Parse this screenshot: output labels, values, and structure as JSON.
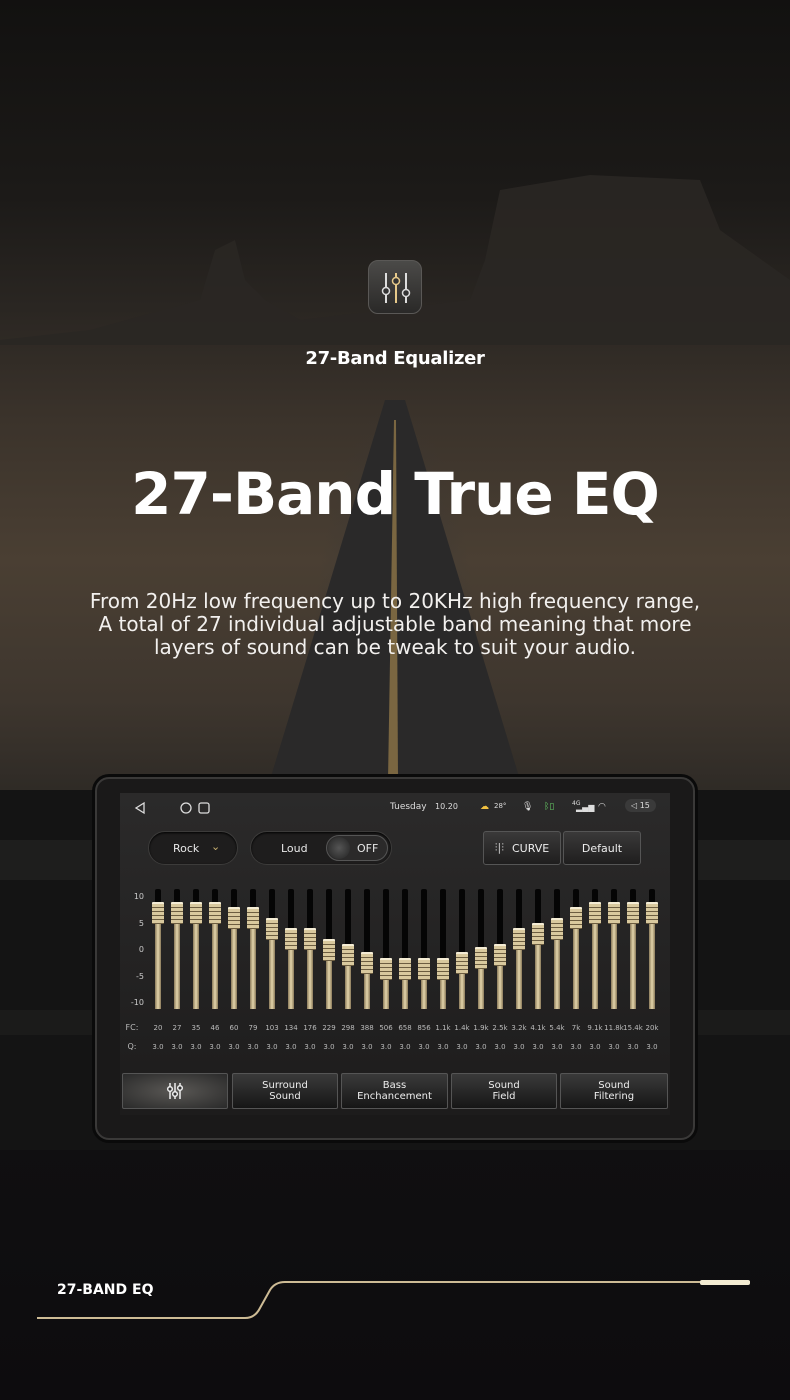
{
  "header": {
    "icon": "equalizer-sliders-icon",
    "subtitle": "27-Band Equalizer",
    "title": "27-Band True EQ",
    "description": [
      "From 20Hz low frequency up to 20KHz high frequency range,",
      "A total of 27 individual adjustable band meaning that more",
      "layers of sound can be tweak to suit your audio."
    ]
  },
  "status_bar": {
    "day": "Tuesday",
    "time": "10.20",
    "temperature": "28°",
    "network": "4G",
    "volume": "15"
  },
  "controls": {
    "preset": "Rock",
    "loud_label": "Loud",
    "loud_state": "OFF",
    "curve_label": "CURVE",
    "default_label": "Default"
  },
  "eq": {
    "axis_ticks": [
      "10",
      "5",
      "0",
      "-5",
      "-10"
    ],
    "range": [
      -10,
      10
    ],
    "fc_label": "FC:",
    "q_label": "Q:",
    "fc": [
      "20",
      "27",
      "35",
      "46",
      "60",
      "79",
      "103",
      "134",
      "176",
      "229",
      "298",
      "388",
      "506",
      "658",
      "856",
      "1.1k",
      "1.4k",
      "1.9k",
      "2.5k",
      "3.2k",
      "4.1k",
      "5.4k",
      "7k",
      "9.1k",
      "11.8k",
      "15.4k",
      "20k"
    ],
    "q": [
      "3.0",
      "3.0",
      "3.0",
      "3.0",
      "3.0",
      "3.0",
      "3.0",
      "3.0",
      "3.0",
      "3.0",
      "3.0",
      "3.0",
      "3.0",
      "3.0",
      "3.0",
      "3.0",
      "3.0",
      "3.0",
      "3.0",
      "3.0",
      "3.0",
      "3.0",
      "3.0",
      "3.0",
      "3.0",
      "3.0",
      "3.0"
    ],
    "gain": [
      7,
      7,
      7,
      7,
      6,
      6,
      4,
      2,
      2,
      0,
      -1,
      -2.5,
      -3.5,
      -3.5,
      -3.5,
      -3.5,
      -2.5,
      -1.5,
      -1,
      2,
      3,
      4,
      6,
      7,
      7,
      7,
      7
    ]
  },
  "tabs": [
    {
      "icon": "equalizer-icon",
      "label": ""
    },
    {
      "label": "Surround\nSound"
    },
    {
      "label": "Bass\nEnchancement"
    },
    {
      "label": "Sound\nField"
    },
    {
      "label": "Sound\nFiltering"
    }
  ],
  "footer": {
    "label": "27-BAND EQ"
  },
  "colors": {
    "accent": "#d8c9a0",
    "background": "#0c0b0c"
  }
}
